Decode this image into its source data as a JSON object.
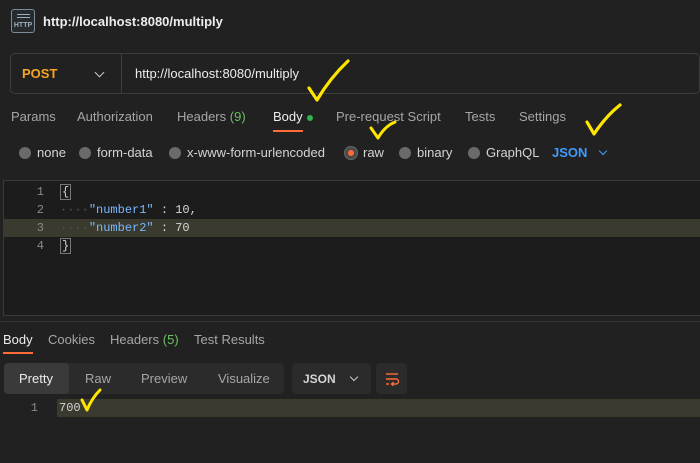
{
  "window": {
    "title": "http://localhost:8080/multiply",
    "icon": "http-file-icon"
  },
  "request": {
    "method": "POST",
    "url": "http://localhost:8080/multiply"
  },
  "request_tabs": [
    {
      "label": "Params"
    },
    {
      "label": "Authorization"
    },
    {
      "label": "Headers",
      "count": "(9)"
    },
    {
      "label": "Body",
      "active": true
    },
    {
      "label": "Pre-request Script"
    },
    {
      "label": "Tests"
    },
    {
      "label": "Settings"
    }
  ],
  "body_types": [
    {
      "label": "none"
    },
    {
      "label": "form-data"
    },
    {
      "label": "x-www-form-urlencoded"
    },
    {
      "label": "raw",
      "selected": true
    },
    {
      "label": "binary"
    },
    {
      "label": "GraphQL"
    }
  ],
  "body_format": "JSON",
  "editor": {
    "line_numbers": [
      "1",
      "2",
      "3",
      "4"
    ],
    "lines": [
      "{",
      "\"number1\" : 10,",
      "\"number2\" : 70",
      "}"
    ],
    "key1": "\"number1\"",
    "value1": " : 10,",
    "key2": "\"number2\"",
    "value2": " : 70",
    "open_brace": "{",
    "close_brace": "}"
  },
  "response_tabs": [
    {
      "label": "Body",
      "active": true
    },
    {
      "label": "Cookies"
    },
    {
      "label": "Headers",
      "count": "(5)"
    },
    {
      "label": "Test Results"
    }
  ],
  "response_view": {
    "modes": [
      "Pretty",
      "Raw",
      "Preview",
      "Visualize"
    ],
    "active_mode": "Pretty",
    "format": "JSON"
  },
  "response_body": {
    "line_number": "1",
    "value": "700"
  },
  "colors": {
    "accent": "#ff6c37",
    "method": "#f5a623",
    "link": "#3f9cff",
    "count": "#6dbe63",
    "annotation": "#ffe600"
  }
}
